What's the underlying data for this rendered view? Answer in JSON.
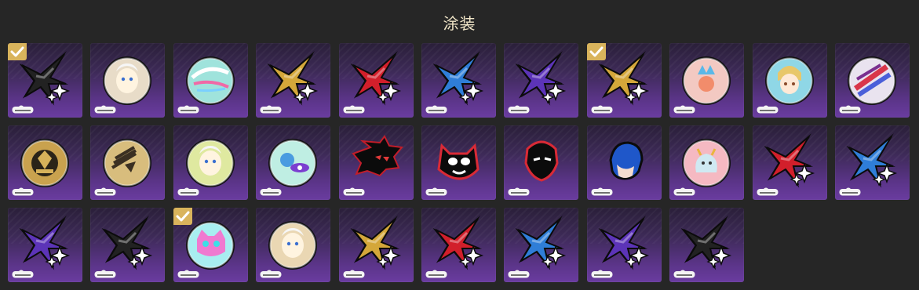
{
  "header": {
    "title": "涂装"
  },
  "colors": {
    "background": "#262626",
    "title": "#f1e6c8",
    "tile_gradient_top": "#2a1f39",
    "tile_gradient_bottom": "#6a3ca0",
    "check_badge": "#d9b45c"
  },
  "skins": [
    {
      "art": "star",
      "color": "#222222",
      "selected": true
    },
    {
      "art": "coin-character",
      "color": "#e8dcc8",
      "selected": false
    },
    {
      "art": "coin-swirl",
      "color": "#9fe3dc",
      "selected": false
    },
    {
      "art": "star",
      "color": "#d4a73a",
      "selected": false
    },
    {
      "art": "star",
      "color": "#d21f2b",
      "selected": false
    },
    {
      "art": "star",
      "color": "#2f7ed8",
      "selected": false
    },
    {
      "art": "star",
      "color": "#5c34b8",
      "selected": false
    },
    {
      "art": "star",
      "color": "#d4a73a",
      "selected": true
    },
    {
      "art": "coin-crown",
      "color": "#f3c9c2",
      "selected": false
    },
    {
      "art": "coin-hero",
      "color": "#8fd7e6",
      "selected": false
    },
    {
      "art": "coin-slash",
      "color": "#e9e3ef",
      "selected": false
    },
    {
      "art": "coin-gold-emblem",
      "color": "#c9a24e",
      "selected": false
    },
    {
      "art": "coin-gold-wings",
      "color": "#d8bd7d",
      "selected": false
    },
    {
      "art": "coin-character-green",
      "color": "#dfe9a0",
      "selected": false
    },
    {
      "art": "coin-planet",
      "color": "#bfeee3",
      "selected": false
    },
    {
      "art": "shadow-hedgehog",
      "color": "#111111",
      "selected": false
    },
    {
      "art": "cat-mask",
      "color": "#111111",
      "selected": false
    },
    {
      "art": "phantom-thief",
      "color": "#111111",
      "selected": false
    },
    {
      "art": "blue-hair-boy",
      "color": "#1f57c9",
      "selected": false
    },
    {
      "art": "coin-pink-monster",
      "color": "#f5b9c2",
      "selected": false
    },
    {
      "art": "star",
      "color": "#d21f2b",
      "selected": false
    },
    {
      "art": "star",
      "color": "#2f7ed8",
      "selected": false
    },
    {
      "art": "star",
      "color": "#5c34b8",
      "selected": false
    },
    {
      "art": "star",
      "color": "#222222",
      "selected": false
    },
    {
      "art": "coin-pink-cat",
      "color": "#a8eef0",
      "selected": true
    },
    {
      "art": "coin-character-white",
      "color": "#ead7b3",
      "selected": false
    },
    {
      "art": "star",
      "color": "#d4a73a",
      "selected": false
    },
    {
      "art": "star",
      "color": "#d21f2b",
      "selected": false
    },
    {
      "art": "star",
      "color": "#2f7ed8",
      "selected": false
    },
    {
      "art": "star",
      "color": "#5c34b8",
      "selected": false
    },
    {
      "art": "star",
      "color": "#222222",
      "selected": false
    }
  ]
}
